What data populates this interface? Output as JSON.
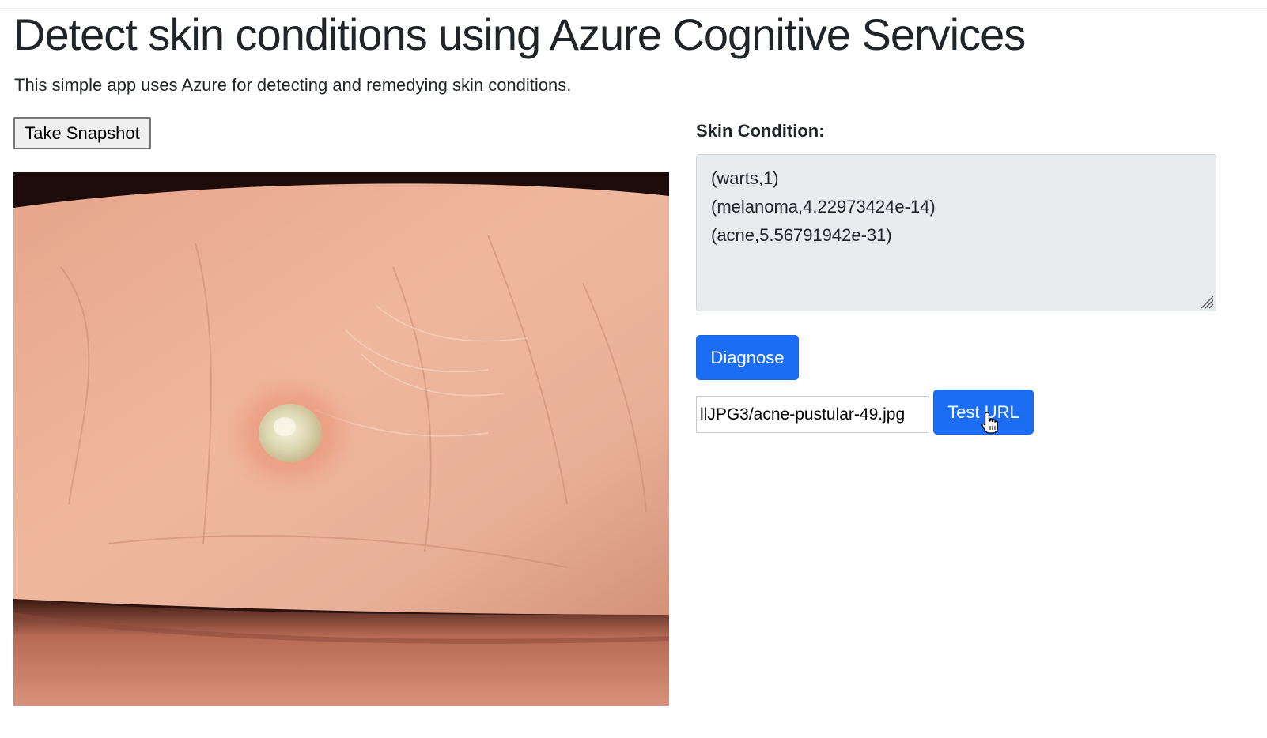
{
  "header": {
    "title": "Detect skin conditions using Azure Cognitive Services",
    "subtitle": "This simple app uses Azure for detecting and remedying skin conditions."
  },
  "left": {
    "snapshot_label": "Take Snapshot",
    "photo_icon": "skin-wart-photo"
  },
  "right": {
    "condition_label": "Skin Condition:",
    "results": [
      "(warts,1)",
      "(melanoma,4.22973424e-14)",
      "(acne,5.56791942e-31)"
    ],
    "diagnose_label": "Diagnose",
    "url_value": "llJPG3/acne-pustular-49.jpg",
    "test_url_label": "Test URL"
  },
  "colors": {
    "primary": "#1b6ef3",
    "result_bg": "#e9ecef"
  },
  "icons": {
    "cursor": "hand-pointer-icon",
    "grip": "resize-grip-icon"
  }
}
